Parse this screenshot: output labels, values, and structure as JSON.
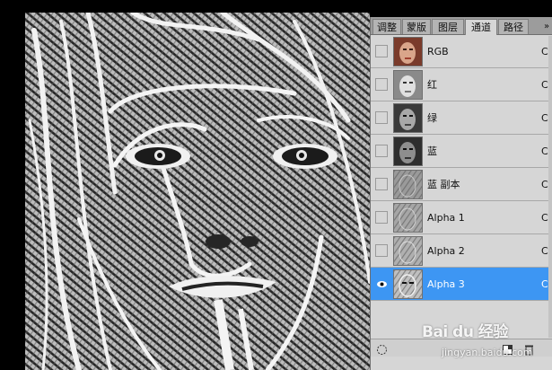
{
  "panel": {
    "tabs": [
      {
        "label": "调整"
      },
      {
        "label": "蒙版"
      },
      {
        "label": "图层"
      },
      {
        "label": "通道"
      },
      {
        "label": "路径"
      }
    ],
    "overflow_label": "»",
    "channels": [
      {
        "name": "RGB",
        "shortcut": "Ctrl",
        "visible": false,
        "selected": false
      },
      {
        "name": "红",
        "shortcut": "Ctrl",
        "visible": false,
        "selected": false
      },
      {
        "name": "绿",
        "shortcut": "Ctrl",
        "visible": false,
        "selected": false
      },
      {
        "name": "蓝",
        "shortcut": "Ctrl",
        "visible": false,
        "selected": false
      },
      {
        "name": "蓝 副本",
        "shortcut": "Ctrl",
        "visible": false,
        "selected": false
      },
      {
        "name": "Alpha 1",
        "shortcut": "Ctrl",
        "visible": false,
        "selected": false
      },
      {
        "name": "Alpha 2",
        "shortcut": "Ctrl",
        "visible": false,
        "selected": false
      },
      {
        "name": "Alpha 3",
        "shortcut": "Ctrl",
        "visible": true,
        "selected": true
      }
    ]
  },
  "watermark": {
    "logo_text": "Bai du 经验",
    "url": "jingyan.baidu.com"
  },
  "colors": {
    "selection": "#3d96f3",
    "panel_bg": "#d6d6d6",
    "canvas_bg": "#000000"
  }
}
